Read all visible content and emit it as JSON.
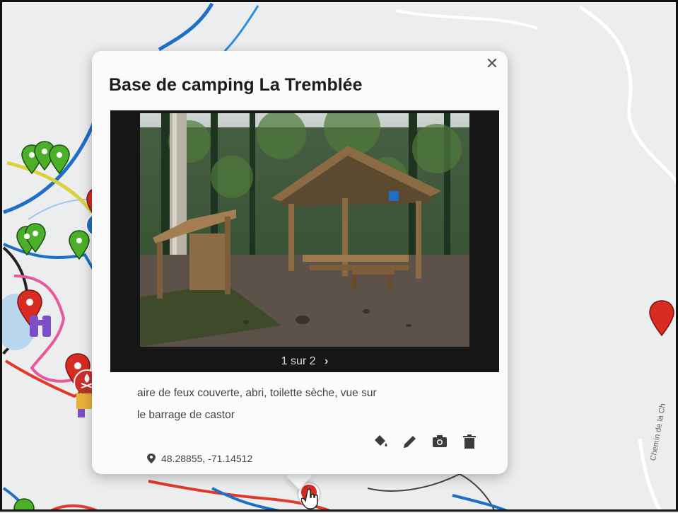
{
  "popup": {
    "title": "Base de camping La Tremblée",
    "close_icon": "close-icon",
    "gallery": {
      "counter": "1 sur 2",
      "next": "›"
    },
    "description_line1": "aire de feux couverte, abri, toilette sèche, vue sur",
    "description_line2": "le barrage de castor",
    "coordinates": "48.28855, -71.14512",
    "icons": {
      "location": "location-pin-icon",
      "fill": "paint-bucket-icon",
      "edit": "pencil-icon",
      "camera": "camera-icon",
      "delete": "trash-icon"
    }
  },
  "map": {
    "road_label": "Chemin de la Ch",
    "colors": {
      "blue_trail": "#1f6fc9",
      "red_trail": "#e03a2a",
      "pink_trail": "#e8589a",
      "yellow_trail": "#d9d23a",
      "black_trail": "#222222",
      "marker_green": "#4caf2a",
      "marker_red": "#d82b22"
    }
  }
}
